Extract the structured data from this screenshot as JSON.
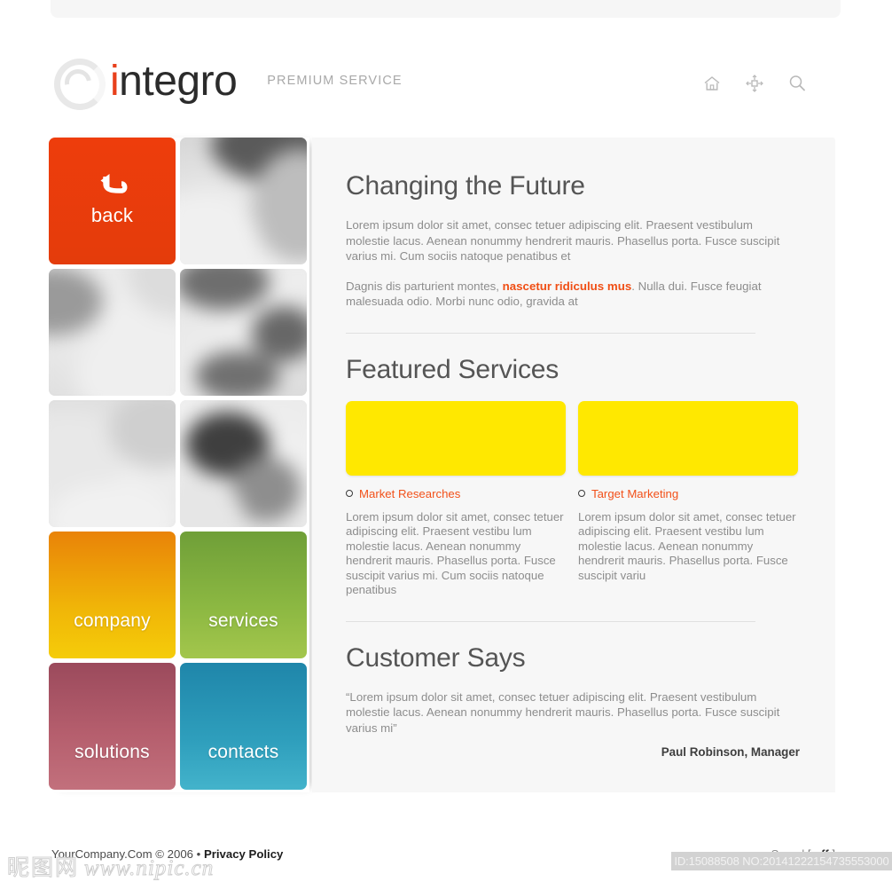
{
  "header": {
    "logo_text_accent": "i",
    "logo_text_rest": "ntegro",
    "tagline": "PREMIUM SERVICE",
    "icons": [
      {
        "name": "home-icon",
        "label": "Home"
      },
      {
        "name": "sitemap-icon",
        "label": "Sitemap"
      },
      {
        "name": "search-icon",
        "label": "Search"
      }
    ]
  },
  "tiles": [
    {
      "key": "back",
      "label": "back",
      "type": "action",
      "color": "#ee3d0c"
    },
    {
      "key": "photo1",
      "label": "",
      "type": "photo"
    },
    {
      "key": "photo2",
      "label": "",
      "type": "photo"
    },
    {
      "key": "photo3",
      "label": "",
      "type": "photo"
    },
    {
      "key": "photo4",
      "label": "",
      "type": "photo"
    },
    {
      "key": "photo5",
      "label": "",
      "type": "photo"
    },
    {
      "key": "company",
      "label": "company",
      "type": "nav",
      "color": "#f0b508"
    },
    {
      "key": "services",
      "label": "services",
      "type": "nav",
      "color": "#8cb842"
    },
    {
      "key": "solutions",
      "label": "solutions",
      "type": "nav",
      "color": "#b55e6d"
    },
    {
      "key": "contacts",
      "label": "contacts",
      "type": "nav",
      "color": "#2e9ebc"
    }
  ],
  "main": {
    "intro": {
      "title": "Changing the Future",
      "paragraph1": "Lorem ipsum dolor sit amet, consec tetuer adipiscing elit. Praesent vestibulum molestie lacus. Aenean nonummy hendrerit mauris. Phasellus porta. Fusce suscipit varius mi. Cum sociis natoque penatibus et",
      "paragraph2_before": "Dagnis dis parturient montes, ",
      "paragraph2_link": "nascetur ridiculus mus",
      "paragraph2_after": ". Nulla dui. Fusce feugiat malesuada odio. Morbi nunc odio, gravida at"
    },
    "featured": {
      "title": "Featured Services",
      "cards": [
        {
          "link": "Market Researches",
          "text": "Lorem ipsum dolor sit amet, consec tetuer adipiscing elit. Praesent vestibu lum molestie lacus. Aenean nonummy hendrerit mauris. Phasellus porta. Fusce suscipit varius mi. Cum sociis natoque penatibus",
          "thumb_color": "#ffe800"
        },
        {
          "link": "Target Marketing",
          "text": "Lorem ipsum dolor sit amet, consec tetuer adipiscing elit. Praesent vestibu lum molestie lacus. Aenean nonummy hendrerit mauris. Phasellus porta. Fusce suscipit variu",
          "thumb_color": "#ffe800"
        }
      ]
    },
    "testimonial": {
      "title": "Customer Says",
      "quote": "“Lorem ipsum dolor sit amet, consec tetuer adipiscing elit. Praesent vestibulum molestie lacus. Aenean nonummy hendrerit mauris. Phasellus porta. Fusce suscipit varius mi”",
      "author": "Paul Robinson, Manager"
    }
  },
  "footer": {
    "copyright": "YourCompany.Com © 2006 • ",
    "privacy_link": "Privacy Policy",
    "sound_label": "Sound",
    "sound_open": "[",
    "sound_state": "off",
    "sound_close": "]"
  },
  "watermark": {
    "site_cjk": "昵图网",
    "site_url": "www.nipic.cn",
    "id_line": "ID:15088508 NO:20141222154735553000"
  }
}
